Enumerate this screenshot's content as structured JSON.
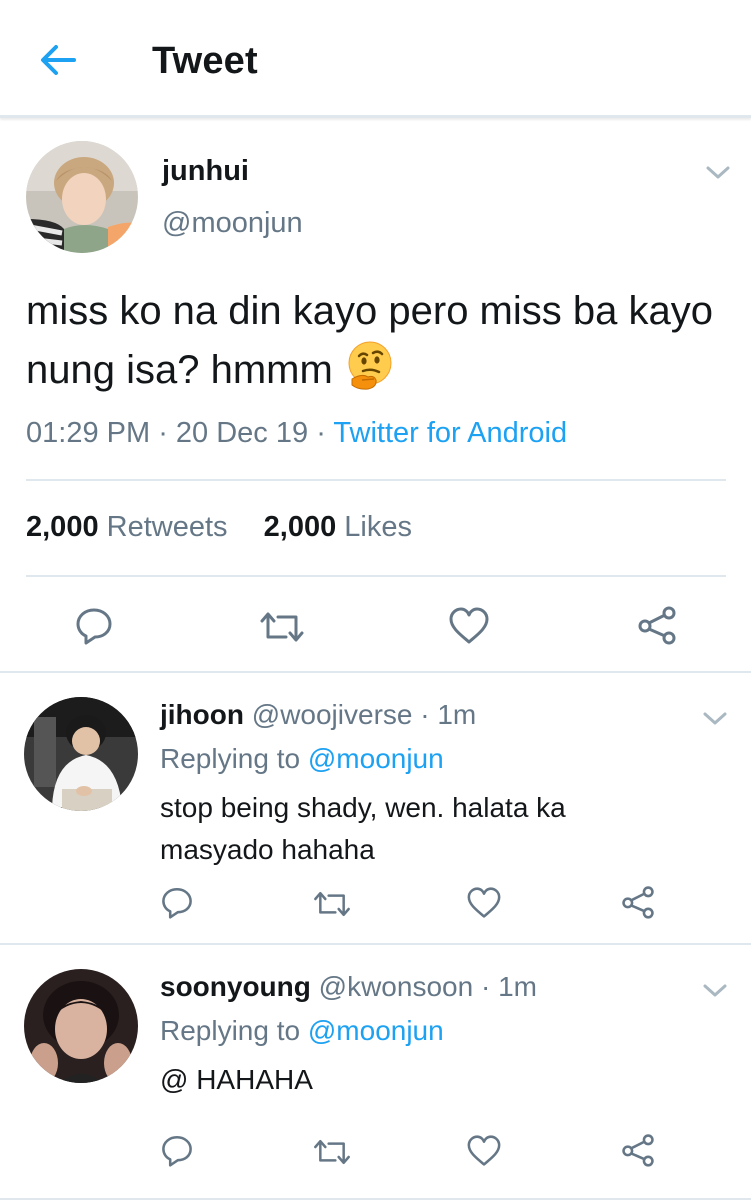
{
  "header": {
    "title": "Tweet"
  },
  "main_tweet": {
    "name": "junhui",
    "handle": "@moonjun",
    "text": "miss ko na din kayo pero miss ba kayo nung isa? hmmm",
    "emoji": "thinking-face",
    "time": "01:29 PM",
    "date": "20 Dec 19",
    "source": "Twitter for Android",
    "retweets_count": "2,000",
    "retweets_label": "Retweets",
    "likes_count": "2,000",
    "likes_label": "Likes"
  },
  "replies": [
    {
      "name": "jihoon",
      "handle": "@woojiverse",
      "time": "1m",
      "replying_label": "Replying to",
      "replying_to": "@moonjun",
      "text": "stop being shady, wen. halata ka masyado hahaha"
    },
    {
      "name": "soonyoung",
      "handle": "@kwonsoon",
      "time": "1m",
      "replying_label": "Replying to",
      "replying_to": "@moonjun",
      "text": "@ HAHAHA"
    }
  ],
  "icons": [
    "back-arrow-icon",
    "chevron-down-icon",
    "reply-icon",
    "retweet-icon",
    "like-icon",
    "share-icon"
  ],
  "colors": {
    "accent": "#1da1f2",
    "secondary_text": "#657786",
    "divider": "#e1e8ed",
    "icon": "#657786"
  }
}
